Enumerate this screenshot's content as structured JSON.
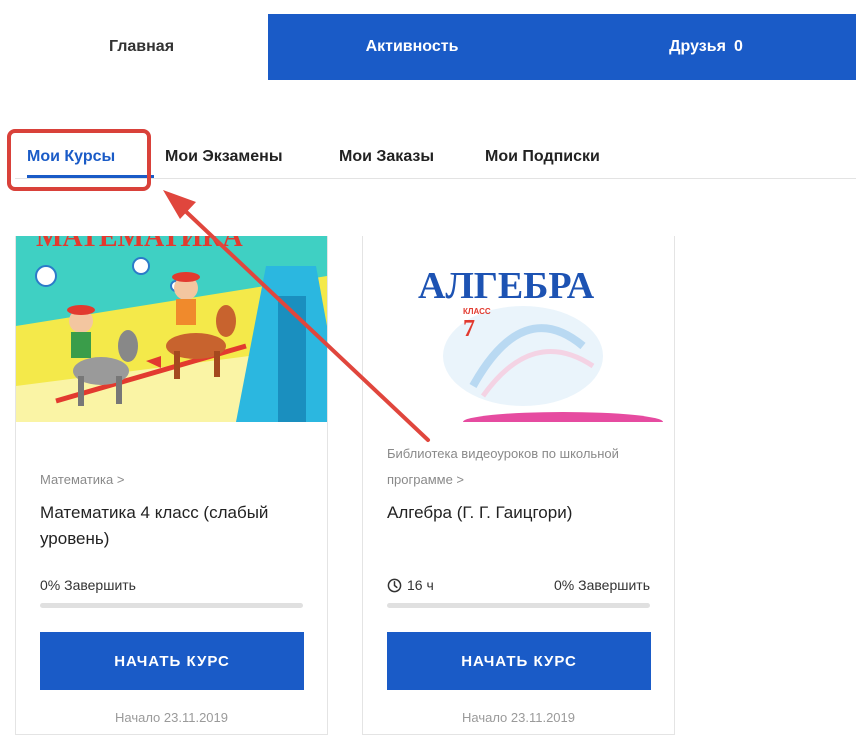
{
  "nav": {
    "home": "Главная",
    "activity": "Активность",
    "friends": "Друзья",
    "friends_count": "0"
  },
  "subtabs": {
    "courses": "Мои Курсы",
    "exams": "Мои Экзамены",
    "orders": "Мои Заказы",
    "subscriptions": "Мои Подписки"
  },
  "courses": [
    {
      "cover_text": "МАТЕМАТИКА",
      "crumb": "Математика >",
      "title": "Математика 4 класс (слабый уровень)",
      "progress": "0% Завершить",
      "progress_value": 0,
      "button": "НАЧАТЬ КУРС",
      "start": "Начало 23.11.2019"
    },
    {
      "cover_title": "АЛГЕБРА",
      "cover_class": "КЛАСС",
      "cover_grade": "7",
      "crumb": "Библиотека видеоуроков по школьной программе >",
      "title": "Алгебра (Г. Г. Гаицгори)",
      "duration": "16 ч",
      "progress": "0% Завершить",
      "progress_value": 0,
      "button": "НАЧАТЬ КУРС",
      "start": "Начало 23.11.2019"
    }
  ],
  "colors": {
    "accent": "#1a5bc7",
    "highlight": "#d9413a"
  }
}
